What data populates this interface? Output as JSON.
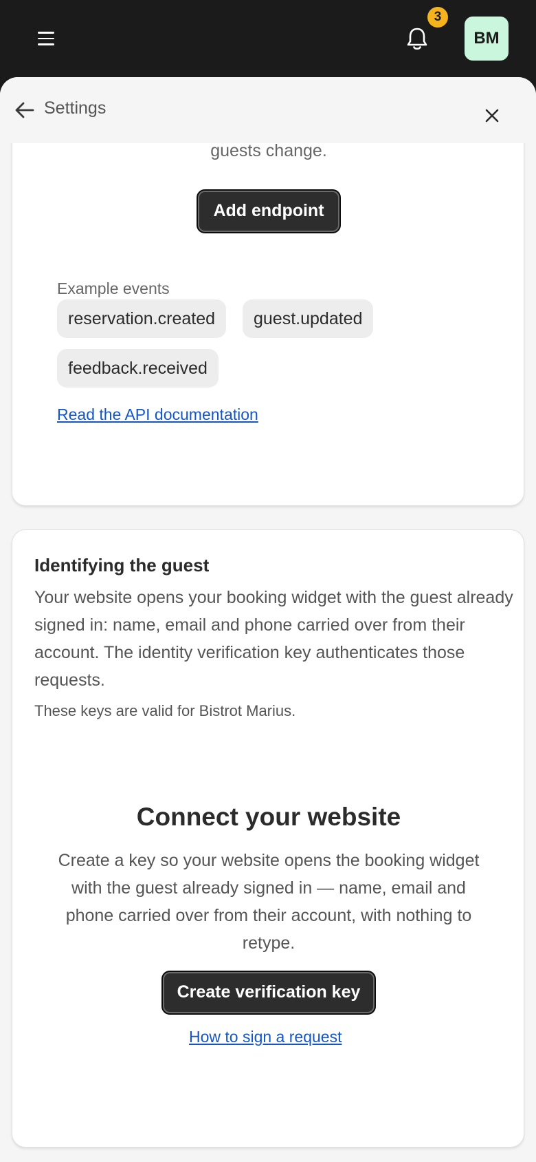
{
  "topbar": {
    "notifications_count": "3",
    "avatar_initials": "BM"
  },
  "header": {
    "title": "Settings"
  },
  "webhooks_card": {
    "description_tail": "guests change.",
    "add_button": "Add endpoint",
    "examples_label": "Example events",
    "example_events": [
      "reservation.created",
      "guest.updated",
      "feedback.received"
    ],
    "docs_link": "Read the API documentation"
  },
  "identity_card": {
    "title": "Identifying the guest",
    "body": "Your website opens your booking widget with the guest already signed in: name, email and phone carried over from their account. The identity verification key authenticates those requests.",
    "note": "These keys are valid for Bistrot Marius.",
    "connect_title": "Connect your website",
    "connect_body": "Create a key so your website opens the booking widget with the guest already signed in — name, email and phone carried over from their account, with nothing to retype.",
    "create_button": "Create verification key",
    "sign_link": "How to sign a request"
  },
  "colors": {
    "accent_badge": "#f5b41e",
    "avatar_bg": "#c9f6dc",
    "link": "#1456c8",
    "button_dark": "#2d2d2d"
  },
  "icons": [
    "menu-icon",
    "bell-icon",
    "arrow-left-icon",
    "close-icon"
  ]
}
